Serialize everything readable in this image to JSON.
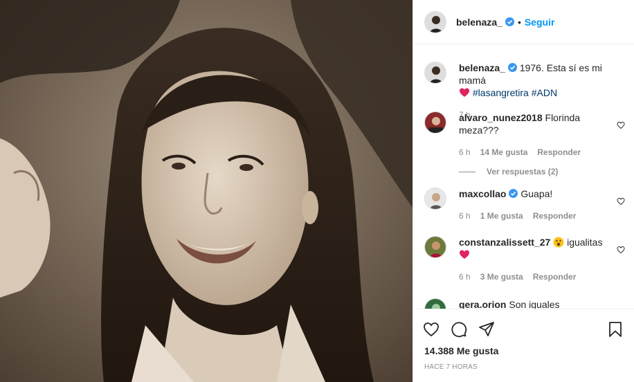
{
  "post": {
    "username": "belenaza_",
    "separator": "•",
    "follow_label": "Seguir"
  },
  "caption": {
    "username": "belenaza_",
    "text": "1976. Esta sí es mi mamá",
    "hashtags": [
      "#lasangretira",
      "#ADN"
    ],
    "time": "7 h"
  },
  "comments": [
    {
      "username": "alvaro_nunez2018",
      "text": "Florinda meza???",
      "time": "6 h",
      "likes": "14 Me gusta",
      "reply": "Responder",
      "view_replies": "Ver respuestas (2)"
    },
    {
      "username": "maxcollao",
      "text": "Guapa!",
      "time": "6 h",
      "likes": "1 Me gusta",
      "reply": "Responder"
    },
    {
      "username": "constanzalissett_27",
      "text": "igualitas",
      "time": "6 h",
      "likes": "3 Me gusta",
      "reply": "Responder"
    },
    {
      "username": "gera.orion",
      "text": "Son iguales"
    }
  ],
  "stats": {
    "likes": "14.388 Me gusta",
    "posted": "HACE 7 HORAS"
  },
  "colors": {
    "link": "#0095f6",
    "hashtag": "#00376b",
    "heart": "#ed4956",
    "muted": "#8e8e8e"
  },
  "icons": [
    "verified-badge-icon",
    "heart-icon",
    "comment-icon",
    "share-icon",
    "bookmark-icon",
    "red-heart-emoji",
    "surprised-face-emoji"
  ]
}
